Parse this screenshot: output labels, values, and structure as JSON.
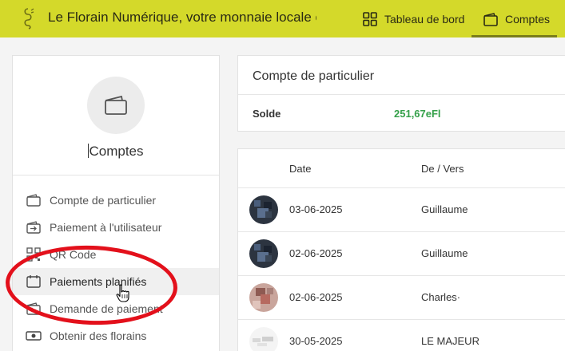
{
  "header": {
    "app_title": "Le Florain Numérique, votre monnaie locale citoye...",
    "tabs": [
      {
        "label": "Tableau de bord",
        "icon": "grid-icon"
      },
      {
        "label": "Comptes",
        "icon": "wallet-icon",
        "active": true
      }
    ],
    "bar_color": "#d4d92a"
  },
  "sidebar": {
    "title": "Comptes",
    "items": [
      {
        "label": "Compte de particulier",
        "icon": "wallet-icon"
      },
      {
        "label": "Paiement à l'utilisateur",
        "icon": "transfer-icon"
      },
      {
        "label": "QR Code",
        "icon": "qr-code-icon"
      },
      {
        "label": "Paiements planifiés",
        "icon": "calendar-icon",
        "active": true
      },
      {
        "label": "Demande de paiement",
        "icon": "payment-request-icon"
      },
      {
        "label": "Obtenir des florains",
        "icon": "banknote-icon"
      }
    ]
  },
  "account": {
    "title": "Compte de particulier",
    "balance_label": "Solde",
    "balance_value": "251,67eFl",
    "balance_color": "#35a04a"
  },
  "transactions": {
    "columns": [
      "Date",
      "De / Vers"
    ],
    "rows": [
      {
        "date": "03-06-2025",
        "counterparty": "Guillaume"
      },
      {
        "date": "02-06-2025",
        "counterparty": "Guillaume"
      },
      {
        "date": "02-06-2025",
        "counterparty": "Charles·"
      },
      {
        "date": "30-05-2025",
        "counterparty": "LE MAJEUR"
      }
    ]
  },
  "annotation_color": "#e3101b"
}
